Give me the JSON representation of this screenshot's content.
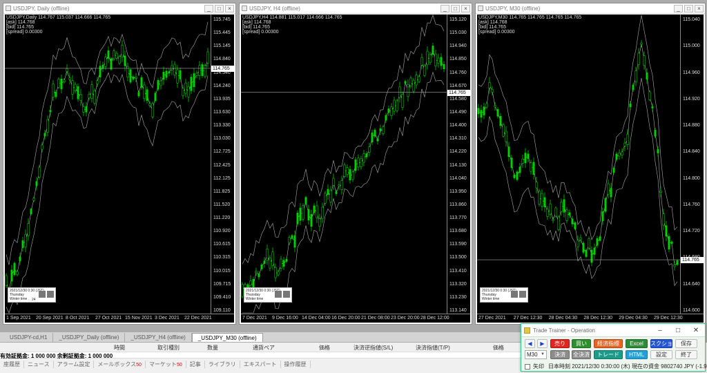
{
  "charts": [
    {
      "title": "USDJPY, Daily (offline)",
      "info": [
        "USDJPY,Daily 114.767 115.037 114.666 114.765",
        "[ask] 114.768",
        "[bid] 114.765",
        "[spread] 0.00300"
      ],
      "price_ticks": [
        "115.745",
        "115.445",
        "115.145",
        "114.840",
        "114.540",
        "114.240",
        "113.935",
        "113.630",
        "113.330",
        "113.030",
        "112.725",
        "112.425",
        "112.125",
        "111.825",
        "111.520",
        "111.220",
        "110.920",
        "110.615",
        "110.315",
        "110.015",
        "109.715",
        "109.410",
        "109.110"
      ],
      "current_price": "114.765",
      "time_ticks": [
        "1 Sep 2021",
        "20 Sep 2021",
        "8 Oct 2021",
        "27 Oct 2021",
        "15 Nov 2021",
        "3 Dec 2021",
        "22 Dec 2021"
      ],
      "clock": [
        "2021/12/30 0:30 (JST)",
        "Thursday",
        "Winter time",
        "24"
      ]
    },
    {
      "title": "USDJPY, H4 (offline)",
      "info": [
        "USDJPY,H4 114.881 115.017 114.666 114.765",
        "[ask] 114.768",
        "[bid] 114.765",
        "[spread] 0.00300"
      ],
      "price_ticks": [
        "115.120",
        "115.030",
        "114.940",
        "114.850",
        "114.760",
        "114.670",
        "114.580",
        "114.490",
        "114.400",
        "114.310",
        "114.220",
        "114.130",
        "114.040",
        "113.950",
        "113.860",
        "113.770",
        "113.680",
        "113.590",
        "113.500",
        "113.410",
        "113.320",
        "113.230",
        "113.140"
      ],
      "current_price": "114.765",
      "time_ticks": [
        "7 Dec 2021",
        "9 Dec 16:00",
        "14 Dec 04:00",
        "16 Dec 20:00",
        "21 Dec 08:00",
        "23 Dec 20:00",
        "28 Dec 12:00"
      ],
      "clock": [
        "2021/12/30 0:30 (JST)",
        "Thursday",
        "Winter time",
        ""
      ]
    },
    {
      "title": "USDJPY, M30 (offline)",
      "info": [
        "USDJPY,M30 114.765 114.765 114.765 114.765",
        "[ask] 114.768",
        "[bid] 114.765",
        "[spread] 0.00300"
      ],
      "price_ticks": [
        "115.040",
        "115.000",
        "114.960",
        "114.920",
        "114.880",
        "114.840",
        "114.800",
        "114.760",
        "114.720",
        "114.680",
        "114.640",
        "114.600"
      ],
      "current_price": "114.765",
      "time_ticks": [
        "27 Dec 2021",
        "27 Dec 12:30",
        "28 Dec 04:30",
        "28 Dec 12:30",
        "29 Dec 04:30",
        "29 Dec 12:30"
      ],
      "clock": [
        "2021/12/30 0:30 (JST)",
        "Thursday",
        "Winter time",
        ""
      ]
    }
  ],
  "tabs": [
    "USDJPY-cd,H1",
    "_USDJPY_Daily (offline)",
    "_USDJPY_H4 (offline)",
    "_USDJPY_M30 (offline)"
  ],
  "terminal": {
    "columns": [
      "時間",
      "取引種別",
      "数量",
      "通貨ペア",
      "価格",
      "決済逆指値(S/L)",
      "決済指値(T/P)",
      "価格"
    ],
    "balance": "有効証拠金: 1 000 000   余剰証拠金: 1 000 000",
    "tabs": [
      {
        "label": "座履歴",
        "count": ""
      },
      {
        "label": "ニュース",
        "count": ""
      },
      {
        "label": "アラーム設定",
        "count": ""
      },
      {
        "label": "メールボックス",
        "count": "50"
      },
      {
        "label": "マーケット",
        "count": "50"
      },
      {
        "label": "記事",
        "count": ""
      },
      {
        "label": "ライブラリ",
        "count": ""
      },
      {
        "label": "エキスパート",
        "count": ""
      },
      {
        "label": "操作履歴",
        "count": ""
      }
    ]
  },
  "dialog": {
    "title": "Trade Trainer - Operation",
    "prev": "◀",
    "next": "▶",
    "buy_sell": {
      "sell": "売り",
      "buy": "買い"
    },
    "stop_trailing": "経済指標",
    "excel": "Excel",
    "screenshot": "スクショ",
    "save": "保存",
    "timeframe": "M30",
    "settle": "決済",
    "settle_all": "全決済",
    "trade": "トレード",
    "html": "HTML",
    "settings": "設定",
    "exit": "終了",
    "arrow_label": "矢印",
    "status": "日本時刻 2021/12/30 0:30:00 (木)    現在の資金 9802740 JPY (-1.97%)",
    "colors": {
      "sell": "#e0261f",
      "buy": "#2f8f2f",
      "stop": "#e8641e",
      "excel": "#2e8b3a",
      "screenshot": "#2456d6",
      "settle": "#8c8c8c",
      "trade": "#1d9b8a",
      "html": "#22a0d8"
    }
  }
}
